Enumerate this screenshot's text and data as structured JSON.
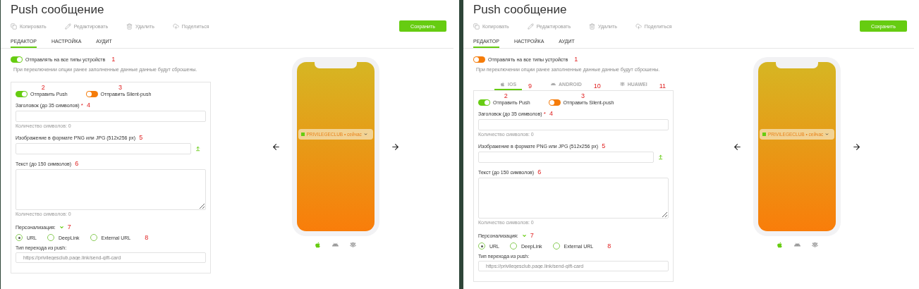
{
  "panels": [
    {
      "title": "Push сообщение",
      "toolbar": [
        {
          "kind": "copy",
          "label": "Копировать"
        },
        {
          "kind": "edit",
          "label": "Редактировать"
        },
        {
          "kind": "delete",
          "label": "Удалить"
        },
        {
          "kind": "share",
          "label": "Поделиться"
        }
      ],
      "save_button": "Сохранить",
      "tabs": [
        {
          "label": "РЕДАКТОР",
          "selected": true
        },
        {
          "label": "НАСТРОЙКА",
          "selected": false
        },
        {
          "label": "АУДИТ",
          "selected": false
        }
      ],
      "all_devices": {
        "label": "Отправлять на все типы устройств",
        "on": true,
        "annotation": "1"
      },
      "hint": "При переключении опции ранее заполненные данные данные будут сброшены.",
      "form": {
        "toggles": [
          {
            "label": "Отправить Push",
            "on": true,
            "annotation": "2"
          },
          {
            "label": "Отправить Silent-push",
            "on": false,
            "annotation": "3"
          }
        ],
        "title_field": {
          "label": "Заголовок (до 35 символов)",
          "required_mark": "*",
          "annotation": "4",
          "counter": "Количество символов: 0"
        },
        "image_field": {
          "label": "Изображение в формате PNG или JPG (512x256 px)",
          "annotation": "5"
        },
        "text_field": {
          "label": "Текст (до 150 символов)",
          "annotation": "6",
          "counter": "Количество символов: 0"
        },
        "personalization": {
          "label": "Персонализация:",
          "annotation": "7"
        },
        "link_types": [
          {
            "label": "URL",
            "selected": true
          },
          {
            "label": "DeepLink",
            "selected": false
          },
          {
            "label": "External URL",
            "selected": false
          }
        ],
        "link_types_annotation": "8",
        "transition": {
          "label": "Тип перехода из push:",
          "placeholder": "https://privilegesclub.page.link/send-gift-card"
        }
      },
      "preview": {
        "notification": "PRIVILEGECLUB • сейчас"
      },
      "os_icons": [
        {
          "kind": "apple",
          "selected": true
        },
        {
          "kind": "android",
          "selected": false
        },
        {
          "kind": "huawei",
          "selected": false
        }
      ]
    },
    {
      "title": "Push сообщение",
      "toolbar": [
        {
          "kind": "copy",
          "label": "Копировать"
        },
        {
          "kind": "edit",
          "label": "Редактировать"
        },
        {
          "kind": "delete",
          "label": "Удалить"
        },
        {
          "kind": "share",
          "label": "Поделиться"
        }
      ],
      "save_button": "Сохранить",
      "tabs": [
        {
          "label": "РЕДАКТОР",
          "selected": true
        },
        {
          "label": "НАСТРОЙКА",
          "selected": false
        },
        {
          "label": "АУДИТ",
          "selected": false
        }
      ],
      "all_devices": {
        "label": "Отправлять на все типы устройств",
        "on": false,
        "annotation": "1"
      },
      "hint": "При переключении опции ранее заполненные данные данные будут сброшены.",
      "device_tabs": [
        {
          "kind": "apple",
          "label": "IOS",
          "selected": true,
          "annotation": "9"
        },
        {
          "kind": "android",
          "label": "ANDROID",
          "selected": false,
          "annotation": "10"
        },
        {
          "kind": "huawei",
          "label": "HUAWEI",
          "selected": false,
          "annotation": "11"
        }
      ],
      "form": {
        "toggles": [
          {
            "label": "Отправить Push",
            "on": true,
            "annotation": "2"
          },
          {
            "label": "Отправить Silent-push",
            "on": false,
            "annotation": "3"
          }
        ],
        "title_field": {
          "label": "Заголовок (до 35 символов)",
          "required_mark": "*",
          "annotation": "4",
          "counter": "Количество символов: 0"
        },
        "image_field": {
          "label": "Изображение в формате PNG или JPG (512x256 px)",
          "annotation": "5"
        },
        "text_field": {
          "label": "Текст (до 150 символов)",
          "annotation": "6",
          "counter": "Количество символов: 0"
        },
        "personalization": {
          "label": "Персонализация:",
          "annotation": "7"
        },
        "link_types": [
          {
            "label": "URL",
            "selected": true
          },
          {
            "label": "DeepLink",
            "selected": false
          },
          {
            "label": "External URL",
            "selected": false
          }
        ],
        "link_types_annotation": "8",
        "transition": {
          "label": "Тип перехода из push:",
          "placeholder": "https://privilegesclub.page.link/send-gift-card"
        }
      },
      "preview": {
        "notification": "PRIVILEGECLUB • сейчас"
      },
      "os_icons": [
        {
          "kind": "apple",
          "selected": true
        },
        {
          "kind": "android",
          "selected": false
        },
        {
          "kind": "huawei",
          "selected": false
        }
      ]
    }
  ]
}
